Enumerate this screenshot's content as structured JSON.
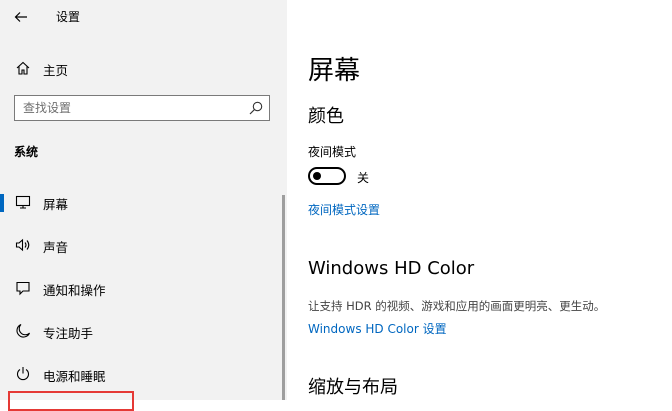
{
  "window": {
    "title": "设置"
  },
  "sidebar": {
    "home_label": "主页",
    "search_placeholder": "查找设置",
    "group_label": "系统",
    "items": [
      {
        "label": "屏幕",
        "icon": "monitor-icon",
        "selected": true
      },
      {
        "label": "声音",
        "icon": "speaker-icon",
        "selected": false
      },
      {
        "label": "通知和操作",
        "icon": "notification-icon",
        "selected": false
      },
      {
        "label": "专注助手",
        "icon": "moon-icon",
        "selected": false
      },
      {
        "label": "电源和睡眠",
        "icon": "power-icon",
        "selected": false
      }
    ]
  },
  "main": {
    "page_title": "屏幕",
    "color_section": {
      "heading": "颜色",
      "night_mode_label": "夜间模式",
      "toggle_state": "关",
      "night_mode_settings_link": "夜间模式设置"
    },
    "hdr_section": {
      "heading": "Windows HD Color",
      "description": "让支持 HDR 的视频、游戏和应用的画面更明亮、更生动。",
      "link": "Windows HD Color 设置"
    },
    "scale_section": {
      "heading": "缩放与布局"
    }
  },
  "colors": {
    "accent": "#0067c0",
    "sidebar_bg": "#f2f2f2",
    "highlight": "#e53935"
  }
}
